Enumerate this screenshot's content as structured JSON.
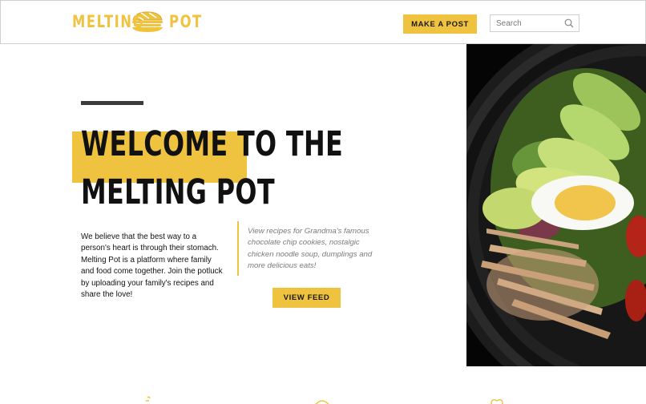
{
  "header": {
    "logo_left": "MELTING",
    "logo_right": "POT",
    "logo_icon": "sandwich-icon",
    "post_button": "MAKE A POST",
    "search_placeholder": "Search",
    "search_icon": "search-icon"
  },
  "hero": {
    "title_line1": "WELCOME TO THE",
    "title_line2": "MELTING POT",
    "intro": "We believe that the best way to a person's heart is through their stomach. Melting Pot is a platform where family and food come together. Join the potluck by uploading your family's recipes and share the love!",
    "quote": "View recipes for Grandma's famous chocolate chip cookies, nostalgic chicken noodle soup, dumplings and more delicious eats!",
    "feed_button": "VIEW FEED"
  },
  "image": {
    "subject": "salad-bowl-image"
  },
  "features": {
    "icons": [
      "chef-hat-icon",
      "cloche-icon",
      "heart-icon"
    ]
  },
  "colors": {
    "accent": "#efc33f",
    "text": "#111111",
    "quote_text": "#7a7a7a",
    "border": "#cfcfcf"
  }
}
